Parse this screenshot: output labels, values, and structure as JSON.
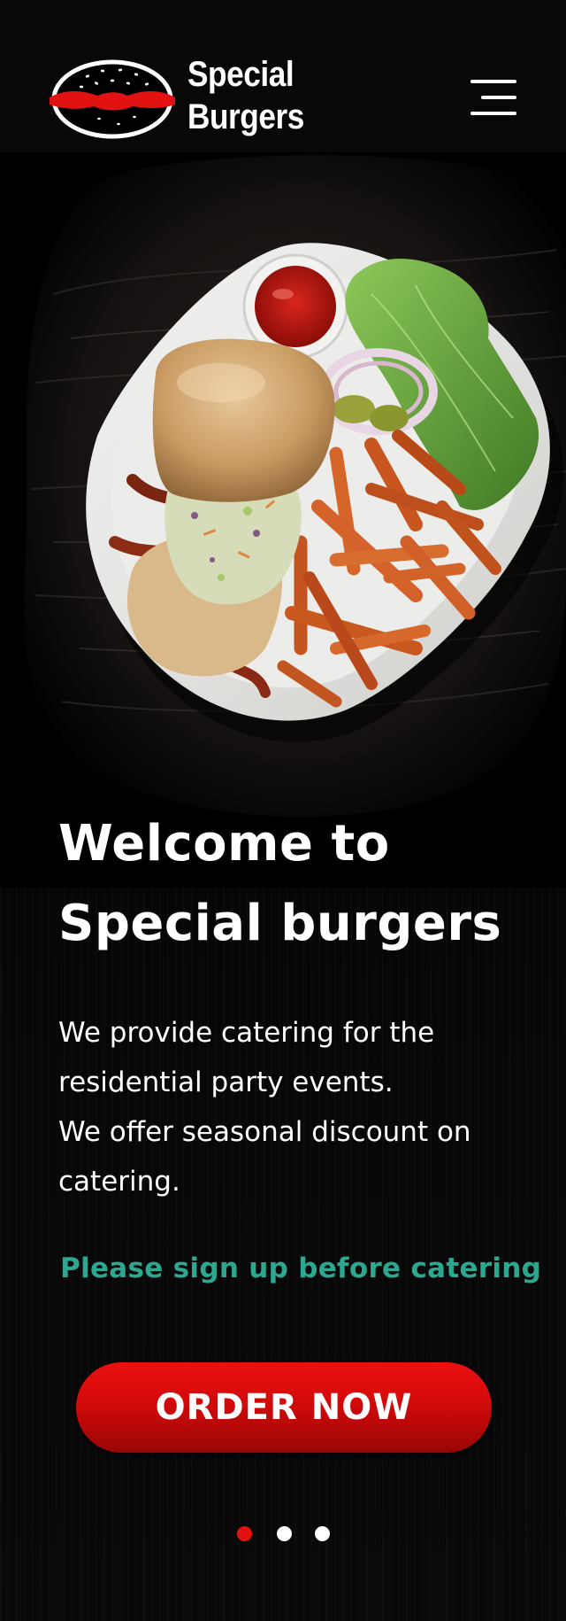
{
  "header": {
    "logo_line1": "Special",
    "logo_line2": "Burgers",
    "menu_icon": "hamburger-menu-icon"
  },
  "hero": {
    "image_alt": "Burger with coleslaw, bacon, sweet potato fries, ketchup and lettuce on a square white plate",
    "title_line1": "Welcome to",
    "title_line2": "Special burgers",
    "description": [
      "We provide catering for the residential party events.",
      "We offer seasonal discount on catering."
    ],
    "signup_text": "Please sign up before catering",
    "order_button": "ORDER NOW"
  },
  "carousel": {
    "active_index": 0,
    "slide_count": 3
  },
  "colors": {
    "accent_red": "#e31212",
    "link_green": "#2ba88f",
    "background": "#050505",
    "text": "#ffffff"
  }
}
